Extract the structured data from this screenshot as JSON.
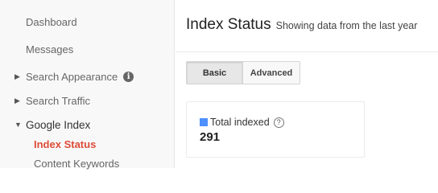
{
  "sidebar": {
    "items": [
      {
        "label": "Dashboard"
      },
      {
        "label": "Messages"
      },
      {
        "label": "Search Appearance",
        "expander": "▶",
        "info": "i"
      },
      {
        "label": "Search Traffic",
        "expander": "▶"
      },
      {
        "label": "Google Index",
        "expander": "▼"
      },
      {
        "label": "Index Status"
      },
      {
        "label": "Content Keywords"
      }
    ]
  },
  "header": {
    "title": "Index Status",
    "subtitle": "Showing data from the last year"
  },
  "view_toggle": {
    "options": [
      "Basic",
      "Advanced"
    ],
    "selected": "Basic"
  },
  "stats": {
    "label": "Total indexed",
    "help": "?",
    "value": "291",
    "swatch_color": "#4d90fe"
  },
  "colors": {
    "active_nav": "#dd4b39",
    "accent": "#4d90fe"
  }
}
